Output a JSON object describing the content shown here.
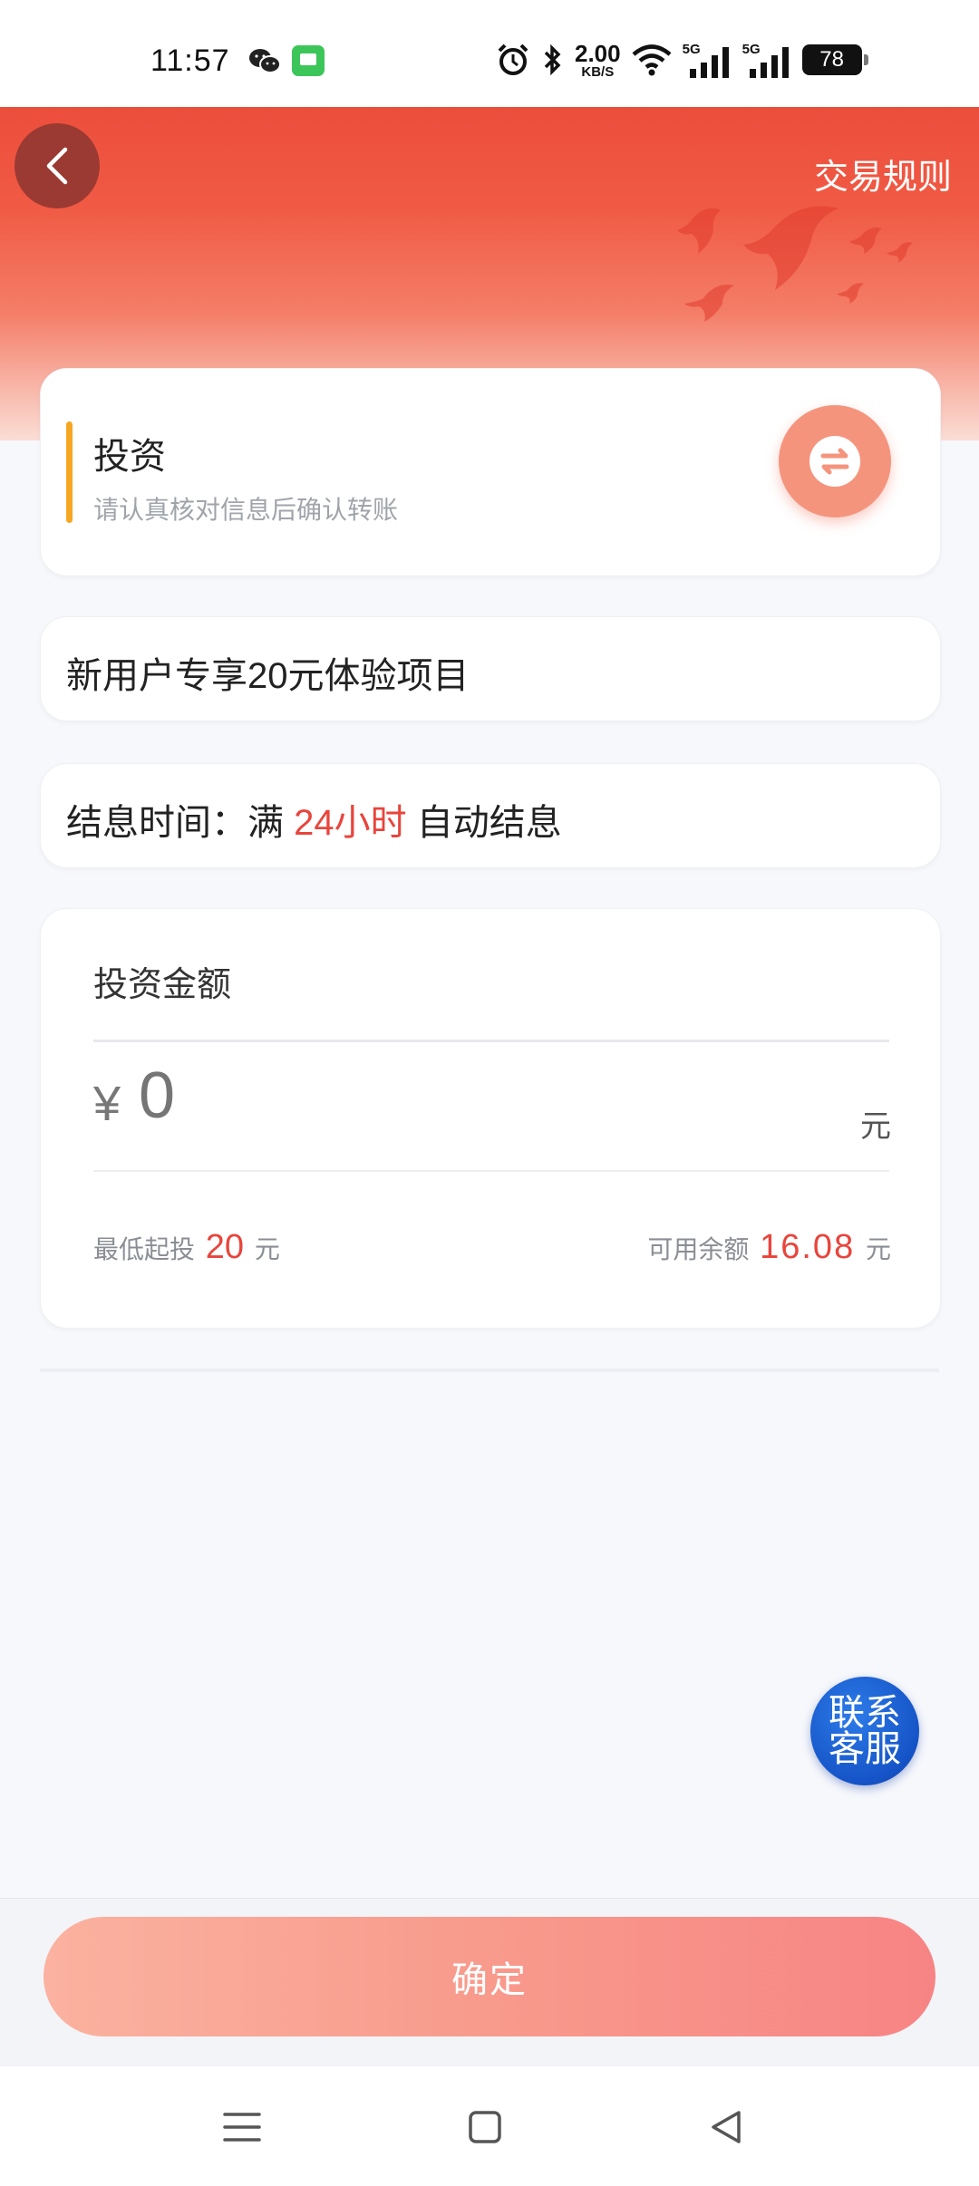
{
  "status_bar": {
    "time": "11:57",
    "net_speed_value": "2.00",
    "net_speed_unit": "KB/S",
    "signal_1_label": "5G",
    "signal_2_label": "5G",
    "battery": "78"
  },
  "header": {
    "rules_link": "交易规则"
  },
  "invest_card": {
    "title": "投资",
    "subtitle": "请认真核对信息后确认转账"
  },
  "project": {
    "name": "新用户专享20元体验项目"
  },
  "settlement": {
    "prefix": "结息时间：满",
    "highlight": "24小时",
    "suffix": "自动结息"
  },
  "amount": {
    "label": "投资金额",
    "currency_symbol": "¥",
    "value": "0",
    "placeholder": "0",
    "unit": "元",
    "min_label": "最低起投",
    "min_value": "20",
    "min_unit": "元",
    "balance_label": "可用余额",
    "balance_value": "16.08",
    "balance_unit": "元"
  },
  "service": {
    "line1": "联系",
    "line2": "客服"
  },
  "footer": {
    "confirm_label": "确定"
  },
  "colors": {
    "brand_red": "#ec4e3c",
    "highlight_red": "#e8453c",
    "accent_orange": "#f5a623",
    "service_blue": "#1554c8"
  },
  "icons": {
    "back": "chevron-left-icon",
    "exchange": "swap-arrows-icon",
    "nav_menu": "menu-icon",
    "nav_home": "home-square-icon",
    "nav_back": "back-triangle-icon"
  }
}
